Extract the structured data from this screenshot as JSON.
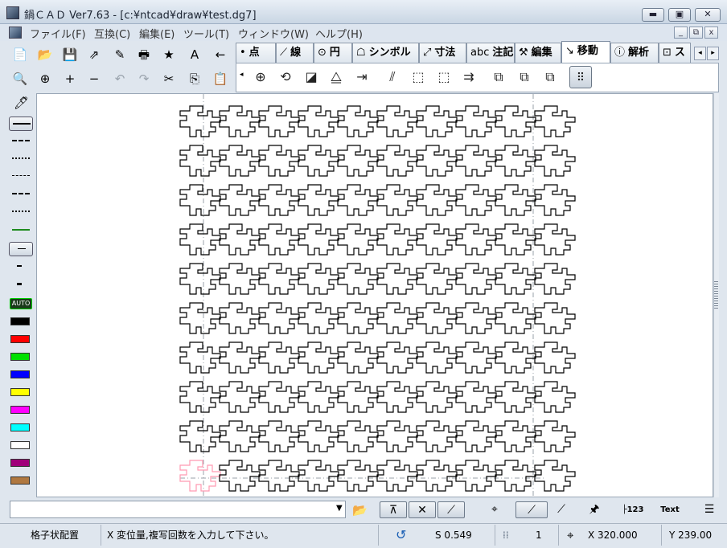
{
  "window": {
    "title": "鍋ＣＡＤ Ver7.63 - [c:¥ntcad¥draw¥test.dg7]",
    "minimize_glyph": "▬",
    "maximize_glyph": "▣",
    "close_glyph": "✕"
  },
  "menu": {
    "items": [
      "ファイル(F)",
      "互換(C)",
      "編集(E)",
      "ツール(T)",
      "ウィンドウ(W)",
      "ヘルプ(H)"
    ],
    "mdi_minimize": "_",
    "mdi_restore": "⧉",
    "mdi_close": "x"
  },
  "toolbar": {
    "row1_icons": [
      "new-document-icon",
      "open-folder-icon",
      "save-icon",
      "export-icon",
      "edit-pen-icon",
      "print-icon",
      "favorite-star-icon",
      "text-font-icon",
      "arrow-left-icon"
    ],
    "row1_glyphs": [
      "📄",
      "📂",
      "💾",
      "⇗",
      "✎",
      "🖶",
      "★",
      "A",
      "←"
    ],
    "row2_icons": [
      "zoom-icon",
      "zoom-window-icon",
      "zoom-in-icon",
      "zoom-out-icon",
      "undo-icon",
      "redo-icon",
      "cut-icon",
      "copy-icon",
      "paste-icon"
    ],
    "row2_glyphs": [
      "🔍",
      "⊕",
      "+",
      "−",
      "↶",
      "↷",
      "✂",
      "⎘",
      "📋"
    ]
  },
  "tabs": {
    "items": [
      {
        "icon": "•",
        "label": "点"
      },
      {
        "icon": "⟋",
        "label": "線"
      },
      {
        "icon": "⊙",
        "label": "円"
      },
      {
        "icon": "☖",
        "label": "シンボル"
      },
      {
        "icon": "⤢",
        "label": "寸法"
      },
      {
        "icon": "abc",
        "label": "注記"
      },
      {
        "icon": "⚒",
        "label": "編集"
      },
      {
        "icon": "↘",
        "label": "移動"
      },
      {
        "icon": "ⓘ",
        "label": "解析"
      },
      {
        "icon": "⊡",
        "label": "ス"
      }
    ],
    "active_index": 7,
    "scroll_left": "◂",
    "scroll_right": "▸",
    "panel_left_arrow": "◂",
    "panel_commands": [
      "⊕",
      "⟲",
      "◪",
      "⧋",
      "⇥",
      "⫽",
      "⬚",
      "⬚",
      "⇉",
      "⧉",
      "⧉",
      "⧉",
      "⠿"
    ],
    "panel_command_names": [
      "move-icon",
      "rotate-icon",
      "mirror-icon",
      "scale-icon",
      "copy-move-icon",
      "parallel-icon",
      "offset-icon",
      "stretch-icon",
      "distribute-icon",
      "array-copy-icon",
      "group-copy-icon",
      "block-copy-icon",
      "grid-arrange-icon"
    ]
  },
  "left_toolbar": {
    "pen_icon": "🖊",
    "auto_label": "AUTO",
    "colors": [
      "#000000",
      "#ff0000",
      "#00e000",
      "#0000ff",
      "#ffff00",
      "#ff00ff",
      "#00ffff",
      "#ffffff",
      "#a0007a",
      "#b07840"
    ]
  },
  "drawing": {
    "rows": 10,
    "cols": 10,
    "shape_color": "#000000",
    "ghost_color": "#ff9ab2",
    "guide_color": "#9aa0a8"
  },
  "command_input": {
    "value": "",
    "dropdown_glyph": "▼",
    "folder_glyph": "📂"
  },
  "snap_buttons": [
    "⊼",
    "✕",
    "⟋",
    "⌖",
    "⟋",
    "⟋",
    "🖈",
    "├123",
    "Text",
    "☰"
  ],
  "snap_button_names": [
    "snap-endpoint-icon",
    "snap-intersection-icon",
    "snap-on-line-icon",
    "snap-center-icon",
    "snap-nearest-icon",
    "snap-free-icon",
    "snap-pin-icon",
    "dimension-value-icon",
    "text-snap-icon",
    "layers-icon"
  ],
  "status": {
    "mode": "格子状配置",
    "prompt": "X 変位量,複写回数を入力して下さい。",
    "rotate_glyph": "↺",
    "scale": "S 0.549",
    "grid_glyph": "⁞⁞",
    "grid_value": "1",
    "crosshair_glyph": "⌖",
    "x": "X 320.000",
    "y": "Y 239.00"
  }
}
